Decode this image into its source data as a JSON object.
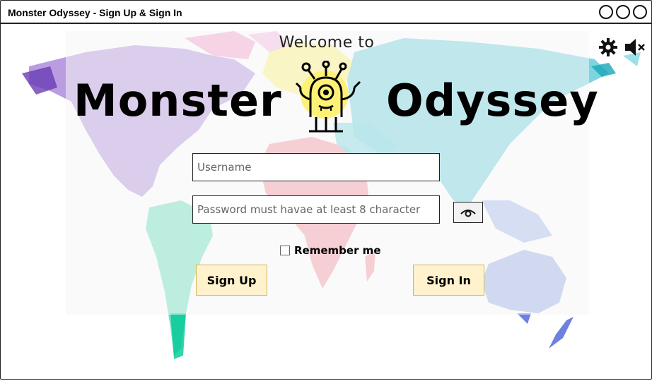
{
  "window": {
    "title": "Monster Odyssey - Sign Up & Sign In"
  },
  "header": {
    "welcome": "Welcome to",
    "title_left": "Monster",
    "title_right": "Odyssey"
  },
  "form": {
    "username_placeholder": "Username",
    "password_placeholder": "Password must havae at least 8 character",
    "remember_label": "Remember me",
    "signup_label": "Sign Up",
    "signin_label": "Sign In"
  },
  "icons": {
    "settings": "gear-icon",
    "mute": "speaker-mute-icon",
    "show_password": "eye-icon",
    "logo": "monster-icon"
  },
  "colors": {
    "button_fill": "#fff2cc",
    "button_border": "#d6b656",
    "logo_yellow": "#fff176"
  }
}
